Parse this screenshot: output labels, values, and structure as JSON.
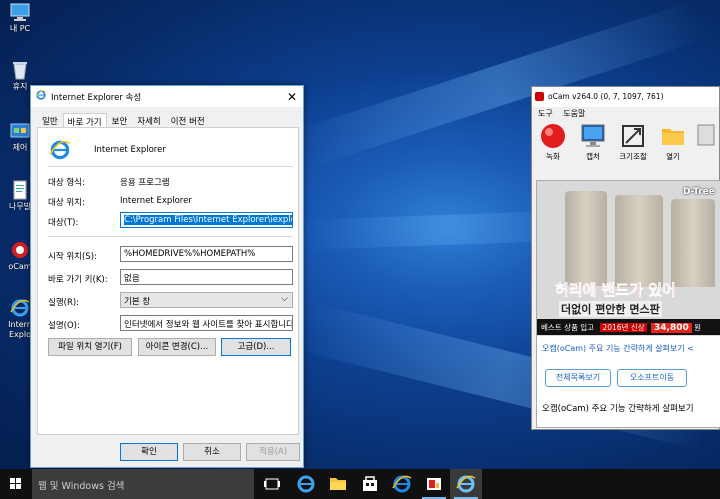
{
  "desktop": {
    "icons": [
      {
        "label": "내 PC",
        "icon": "computer-icon"
      },
      {
        "label": "휴지",
        "icon": "recycle-bin-icon"
      },
      {
        "label": "제어",
        "icon": "control-panel-icon"
      },
      {
        "label": "나무발",
        "icon": "document-icon"
      },
      {
        "label": "oCam",
        "icon": "ocam-icon"
      },
      {
        "label": "Intern",
        "icon": "ie-icon"
      },
      {
        "label": "Explo",
        "icon": ""
      }
    ]
  },
  "dialog": {
    "title": "Internet Explorer 속성",
    "tabs": [
      "일반",
      "바로 가기",
      "보안",
      "자세히",
      "이전 버전"
    ],
    "active_tab": "바로 가기",
    "app_name": "Internet Explorer",
    "target_type_label": "대상 형식:",
    "target_type_value": "응용 프로그램",
    "target_location_label": "대상 위치:",
    "target_location_value": "Internet Explorer",
    "target_label": "대상(T):",
    "target_value": "C:\\Program Files\\Internet Explorer\\iexplore.exe\"",
    "start_in_label": "시작 위치(S):",
    "start_in_value": "%HOMEDRIVE%%HOMEPATH%",
    "shortcut_key_label": "바로 가기 키(K):",
    "shortcut_key_value": "없음",
    "run_label": "실행(R):",
    "run_value": "기본 창",
    "comment_label": "설명(O):",
    "comment_value": "인터넷에서 정보와 웹 사이트를 찾아 표시합니다.",
    "open_location_button": "파일 위치 열기(F)",
    "change_icon_button": "아이콘 변경(C)...",
    "advanced_button": "고급(D)...",
    "ok_button": "확인",
    "cancel_button": "취소",
    "apply_button": "적용(A)"
  },
  "ocam": {
    "title": "oCam v264.0 (0, 7, 1097, 761)",
    "menu": [
      "도구",
      "도움말"
    ],
    "tools": [
      "녹화",
      "캡처",
      "크기조절",
      "열기"
    ],
    "ad": {
      "brand": "D-Tree",
      "headline": "허리에 밴드가 있어",
      "subline": "더없이 편안한 면스판",
      "best_label": "베스트 상품 입고",
      "new_tag": "2016년 신상",
      "price": "34,800",
      "price_unit": "원",
      "link": "오캠(oCam) 주요 기능 간략하게 살펴보기  <",
      "button1": "전체목록보기",
      "button2": "오소프트이동",
      "post_title": "오캠(oCam) 주요 기능 간략하게 살펴보기"
    }
  },
  "taskbar": {
    "search_placeholder": "웹 및 Windows 검색"
  }
}
